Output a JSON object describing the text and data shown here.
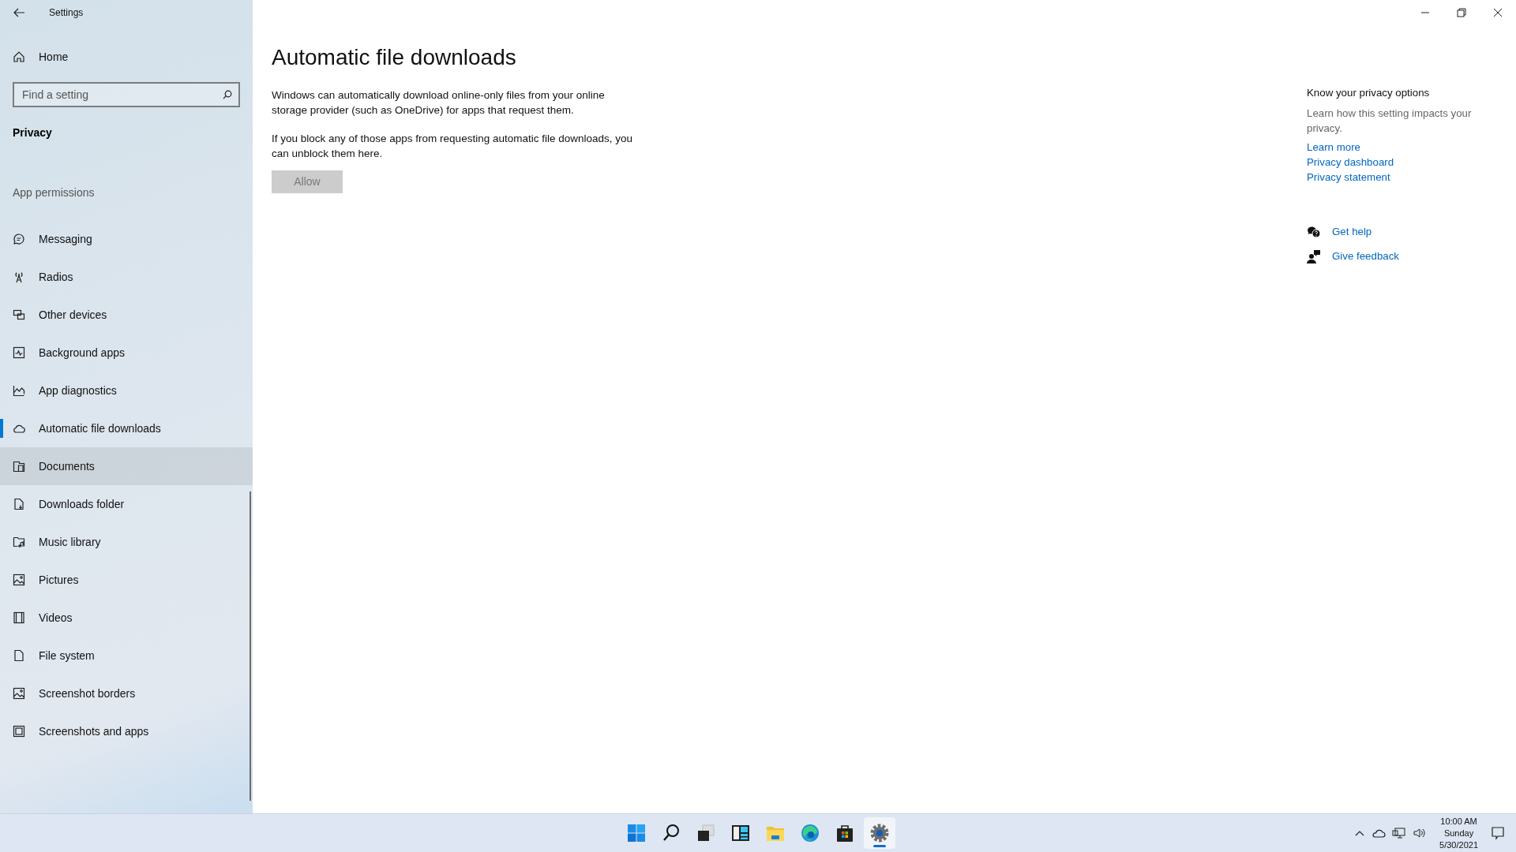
{
  "window": {
    "title": "Settings"
  },
  "sidebar": {
    "home": "Home",
    "search": {
      "placeholder": "Find a setting"
    },
    "section": "Privacy",
    "group": "App permissions",
    "items": [
      {
        "label": "Messaging",
        "selected": false,
        "hovered": false
      },
      {
        "label": "Radios",
        "selected": false,
        "hovered": false
      },
      {
        "label": "Other devices",
        "selected": false,
        "hovered": false
      },
      {
        "label": "Background apps",
        "selected": false,
        "hovered": false
      },
      {
        "label": "App diagnostics",
        "selected": false,
        "hovered": false
      },
      {
        "label": "Automatic file downloads",
        "selected": true,
        "hovered": false
      },
      {
        "label": "Documents",
        "selected": false,
        "hovered": true
      },
      {
        "label": "Downloads folder",
        "selected": false,
        "hovered": false
      },
      {
        "label": "Music library",
        "selected": false,
        "hovered": false
      },
      {
        "label": "Pictures",
        "selected": false,
        "hovered": false
      },
      {
        "label": "Videos",
        "selected": false,
        "hovered": false
      },
      {
        "label": "File system",
        "selected": false,
        "hovered": false
      },
      {
        "label": "Screenshot borders",
        "selected": false,
        "hovered": false
      },
      {
        "label": "Screenshots and apps",
        "selected": false,
        "hovered": false
      }
    ]
  },
  "main": {
    "title": "Automatic file downloads",
    "paragraphs": [
      "Windows can automatically download online-only files from your online storage provider (such as OneDrive) for apps that request them.",
      "If you block any of those apps from requesting automatic file downloads, you can unblock them here."
    ],
    "button": {
      "label": "Allow",
      "disabled": true
    }
  },
  "aside": {
    "heading": "Know your privacy options",
    "text": "Learn how this setting impacts your privacy.",
    "links": [
      "Learn more",
      "Privacy dashboard",
      "Privacy statement"
    ],
    "help": [
      {
        "kind": "help",
        "label": "Get help"
      },
      {
        "kind": "feedback",
        "label": "Give feedback"
      }
    ]
  },
  "taskbar": {
    "apps": [
      {
        "selected": false
      },
      {
        "selected": false
      },
      {
        "selected": false
      },
      {
        "selected": false
      },
      {
        "selected": false
      },
      {
        "selected": false
      },
      {
        "selected": false
      },
      {
        "selected": true
      }
    ],
    "clock": {
      "time": "10:00 AM",
      "day": "Sunday",
      "date": "5/30/2021"
    }
  }
}
